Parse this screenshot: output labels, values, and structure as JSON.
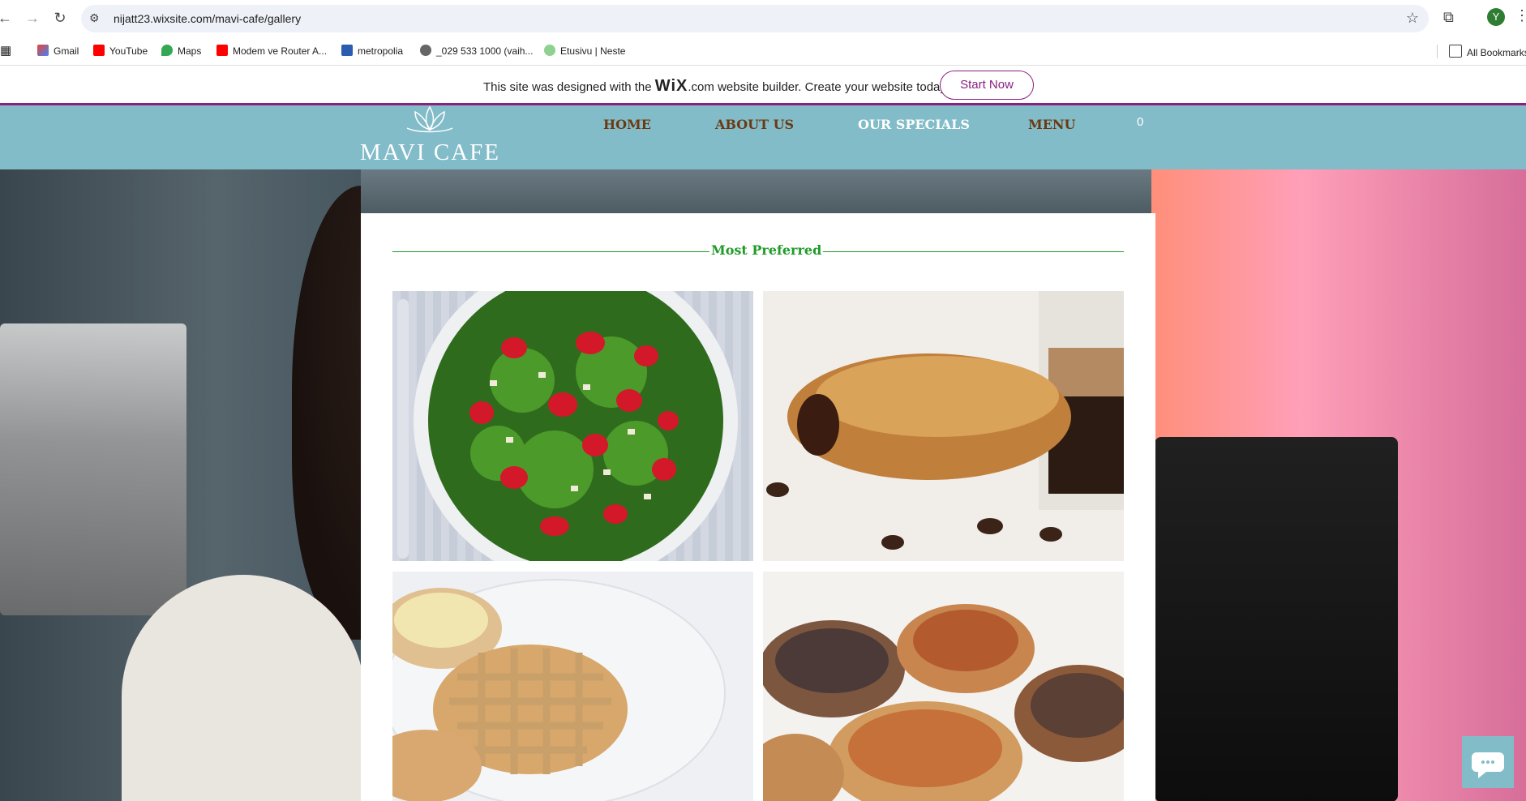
{
  "browser": {
    "url": "nijatt23.wixsite.com/mavi-cafe/gallery",
    "profile_initial": "Y",
    "bookmarks": [
      "Gmail",
      "YouTube",
      "Maps",
      "Modem ve Router A...",
      "metropolia",
      "_029 533 1000 (vaih...",
      "Etusivu | Neste"
    ],
    "all_bookmarks": "All Bookmarks"
  },
  "wix_banner": {
    "text_before": "This site was designed with the",
    "brand": "WiX",
    "text_after": ".com website builder. Create your website today.",
    "cta": "Start Now"
  },
  "site": {
    "logo": "MAVI CAFE",
    "menu": [
      "HOME",
      "ABOUT US",
      "OUR SPECIALS",
      "MENU"
    ],
    "cart_count": "0"
  },
  "gallery": {
    "title": "Most Preferred",
    "images": [
      "strawberry-arugula-salad",
      "chocolate-croissant-espresso",
      "lattice-tarts",
      "mini-quiches"
    ]
  },
  "colors": {
    "header_bg": "#82bcc8",
    "accent_green": "#1e9b28",
    "wix_purple": "#8a2080",
    "menu_brown": "#6b3a14",
    "menu_white": "#ffffff"
  }
}
